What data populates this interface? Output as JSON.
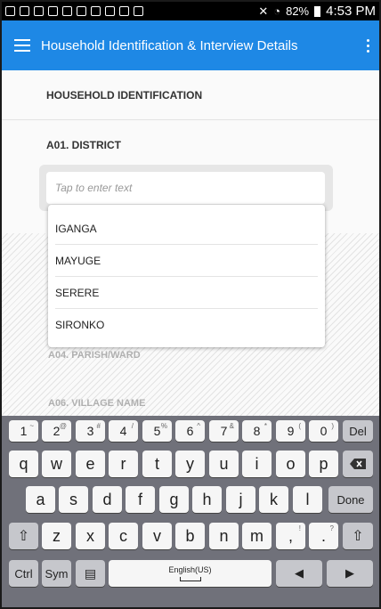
{
  "status_bar": {
    "battery": "82%",
    "time": "4:53 PM"
  },
  "appbar": {
    "title": "Household Identification & Interview Details"
  },
  "section": {
    "heading": "HOUSEHOLD IDENTIFICATION"
  },
  "question": {
    "label": "A01. DISTRICT",
    "placeholder": "Tap to enter text"
  },
  "dropdown_options": [
    "IGANGA",
    "MAYUGE",
    "SERERE",
    "SIRONKO"
  ],
  "dimmed_labels": [
    "A04. PARISH/WARD",
    "A06. VILLAGE NAME"
  ],
  "keyboard": {
    "number_row": [
      {
        "main": "1",
        "alt": "~"
      },
      {
        "main": "2",
        "alt": "@"
      },
      {
        "main": "3",
        "alt": "#"
      },
      {
        "main": "4",
        "alt": "/"
      },
      {
        "main": "5",
        "alt": "%"
      },
      {
        "main": "6",
        "alt": "^"
      },
      {
        "main": "7",
        "alt": "&"
      },
      {
        "main": "8",
        "alt": "*"
      },
      {
        "main": "9",
        "alt": "("
      },
      {
        "main": "0",
        "alt": ")"
      }
    ],
    "del_label": "Del",
    "row_q": [
      "q",
      "w",
      "e",
      "r",
      "t",
      "y",
      "u",
      "i",
      "o",
      "p"
    ],
    "row_a": [
      "a",
      "s",
      "d",
      "f",
      "g",
      "h",
      "j",
      "k",
      "l"
    ],
    "done_label": "Done",
    "row_z": [
      "z",
      "x",
      "c",
      "v",
      "b",
      "n",
      "m"
    ],
    "punct_1": ",",
    "punct_1_alt": "!",
    "punct_2": ".",
    "punct_2_alt": "?",
    "ctrl_label": "Ctrl",
    "sym_label": "Sym",
    "space_label": "English(US)"
  }
}
